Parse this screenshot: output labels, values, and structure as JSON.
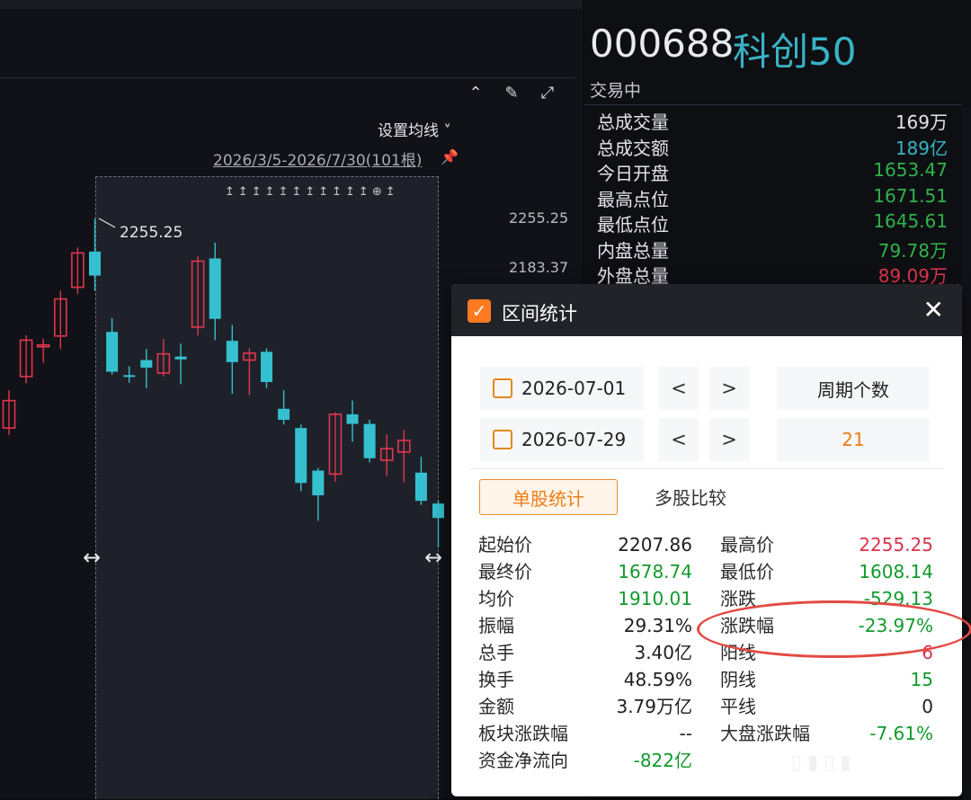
{
  "chart": {
    "ma_setting": "设置均线 ˅",
    "range_label": "2026/3/5-2026/7/30(101根)",
    "high_marker": "2255.25",
    "price_axis": [
      "2255.25",
      "2183.37"
    ],
    "selection_icons": "↥↥↥↥↥↥↥↥↥↥↥⊕↥",
    "candles": [
      {
        "o": 1950,
        "c": 1990,
        "h": 2005,
        "l": 1940
      },
      {
        "o": 2025,
        "c": 2078,
        "h": 2085,
        "l": 2015
      },
      {
        "o": 2070,
        "c": 2071,
        "h": 2080,
        "l": 2045
      },
      {
        "o": 2084,
        "c": 2138,
        "h": 2150,
        "l": 2065
      },
      {
        "o": 2155,
        "c": 2205,
        "h": 2213,
        "l": 2145
      },
      {
        "o": 2207,
        "c": 2172,
        "h": 2255.25,
        "l": 2150
      },
      {
        "o": 2090,
        "c": 2032,
        "h": 2110,
        "l": 2028
      },
      {
        "o": 2027,
        "c": 2026,
        "h": 2040,
        "l": 2016
      },
      {
        "o": 2049,
        "c": 2038,
        "h": 2065,
        "l": 2008
      },
      {
        "o": 2030,
        "c": 2058,
        "h": 2080,
        "l": 2025
      },
      {
        "o": 2054,
        "c": 2050,
        "h": 2073,
        "l": 2014
      },
      {
        "o": 2097,
        "c": 2193,
        "h": 2200,
        "l": 2085
      },
      {
        "o": 2197,
        "c": 2109,
        "h": 2220,
        "l": 2078
      },
      {
        "o": 2077,
        "c": 2046,
        "h": 2100,
        "l": 2000
      },
      {
        "o": 2049,
        "c": 2059,
        "h": 2066,
        "l": 1998
      },
      {
        "o": 2061,
        "c": 2017,
        "h": 2066,
        "l": 2008
      },
      {
        "o": 1978,
        "c": 1962,
        "h": 2005,
        "l": 1955
      },
      {
        "o": 1950,
        "c": 1870,
        "h": 1955,
        "l": 1858
      },
      {
        "o": 1888,
        "c": 1852,
        "h": 1892,
        "l": 1815
      },
      {
        "o": 1883,
        "c": 1970,
        "h": 1973,
        "l": 1872
      },
      {
        "o": 1970,
        "c": 1956,
        "h": 1990,
        "l": 1930
      },
      {
        "o": 1956,
        "c": 1906,
        "h": 1962,
        "l": 1900
      },
      {
        "o": 1903,
        "c": 1920,
        "h": 1941,
        "l": 1880
      },
      {
        "o": 1915,
        "c": 1932,
        "h": 1947,
        "l": 1871
      },
      {
        "o": 1885,
        "c": 1844,
        "h": 1908,
        "l": 1838
      },
      {
        "o": 1840,
        "c": 1819,
        "h": 1845,
        "l": 1776
      }
    ]
  },
  "quote": {
    "code": "000688",
    "name": "科创50",
    "status": "交易中",
    "rows": [
      {
        "k": "总成交量",
        "v": "169万",
        "color": "#e3e5ea"
      },
      {
        "k": "总成交额",
        "v": "189亿",
        "color": "#39b3c4"
      },
      {
        "k": "今日开盘",
        "v": "1653.47",
        "color": "#2fb34a"
      },
      {
        "k": "最高点位",
        "v": "1671.51",
        "color": "#2fb34a"
      },
      {
        "k": "最低点位",
        "v": "1645.61",
        "color": "#2fb34a"
      },
      {
        "k": "内盘总量",
        "v": "79.78万",
        "color": "#2fb34a"
      },
      {
        "k": "外盘总量",
        "v": "89.09万",
        "color": "#e0364d"
      }
    ]
  },
  "dialog": {
    "title": "区间统计",
    "close": "✕",
    "start_date": "2026-07-01",
    "end_date": "2026-07-29",
    "prev": "<",
    "next": ">",
    "period_label": "周期个数",
    "period_value": "21",
    "tab_single": "单股统计",
    "tab_multi": "多股比较",
    "stats_left": [
      {
        "k": "起始价",
        "v": "2207.86",
        "c": "black"
      },
      {
        "k": "最终价",
        "v": "1678.74",
        "c": "green"
      },
      {
        "k": "均价",
        "v": "1910.01",
        "c": "green"
      },
      {
        "k": "振幅",
        "v": "29.31%",
        "c": "black"
      },
      {
        "k": "总手",
        "v": "3.40亿",
        "c": "black"
      },
      {
        "k": "换手",
        "v": "48.59%",
        "c": "black"
      },
      {
        "k": "金额",
        "v": "3.79万亿",
        "c": "black"
      },
      {
        "k": "板块涨跌幅",
        "v": "--",
        "c": "black"
      },
      {
        "k": "资金净流向",
        "v": "-822亿",
        "c": "green"
      }
    ],
    "stats_right": [
      {
        "k": "最高价",
        "v": "2255.25",
        "c": "red"
      },
      {
        "k": "最低价",
        "v": "1608.14",
        "c": "green"
      },
      {
        "k": "涨跌",
        "v": "-529.13",
        "c": "green"
      },
      {
        "k": "涨跌幅",
        "v": "-23.97%",
        "c": "green"
      },
      {
        "k": "阳线",
        "v": "6",
        "c": "red"
      },
      {
        "k": "阴线",
        "v": "15",
        "c": "green"
      },
      {
        "k": "平线",
        "v": "0",
        "c": "black"
      },
      {
        "k": "大盘涨跌幅",
        "v": "-7.61%",
        "c": "green"
      }
    ]
  },
  "colors": {
    "up": "#e0364d",
    "down": "#35c0cf"
  }
}
